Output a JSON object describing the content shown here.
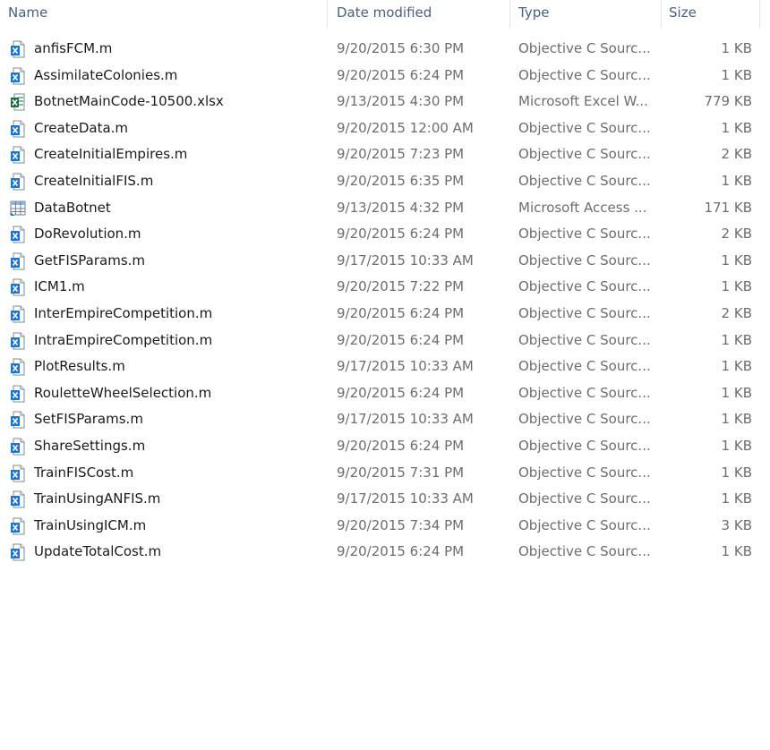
{
  "columns": {
    "name": "Name",
    "date": "Date modified",
    "type": "Type",
    "size": "Size"
  },
  "files": [
    {
      "name": "anfisFCM.m",
      "date": "9/20/2015 6:30 PM",
      "type": "Objective C Sourc...",
      "size": "1 KB",
      "icon": "objective-c-file-icon"
    },
    {
      "name": "AssimilateColonies.m",
      "date": "9/20/2015 6:24 PM",
      "type": "Objective C Sourc...",
      "size": "1 KB",
      "icon": "objective-c-file-icon"
    },
    {
      "name": "BotnetMainCode-10500.xlsx",
      "date": "9/13/2015 4:30 PM",
      "type": "Microsoft Excel W...",
      "size": "779 KB",
      "icon": "excel-file-icon"
    },
    {
      "name": "CreateData.m",
      "date": "9/20/2015 12:00 AM",
      "type": "Objective C Sourc...",
      "size": "1 KB",
      "icon": "objective-c-file-icon"
    },
    {
      "name": "CreateInitialEmpires.m",
      "date": "9/20/2015 7:23 PM",
      "type": "Objective C Sourc...",
      "size": "2 KB",
      "icon": "objective-c-file-icon"
    },
    {
      "name": "CreateInitialFIS.m",
      "date": "9/20/2015 6:35 PM",
      "type": "Objective C Sourc...",
      "size": "1 KB",
      "icon": "objective-c-file-icon"
    },
    {
      "name": "DataBotnet",
      "date": "9/13/2015 4:32 PM",
      "type": "Microsoft Access ...",
      "size": "171 KB",
      "icon": "access-table-icon"
    },
    {
      "name": "DoRevolution.m",
      "date": "9/20/2015 6:24 PM",
      "type": "Objective C Sourc...",
      "size": "2 KB",
      "icon": "objective-c-file-icon"
    },
    {
      "name": "GetFISParams.m",
      "date": "9/17/2015 10:33 AM",
      "type": "Objective C Sourc...",
      "size": "1 KB",
      "icon": "objective-c-file-icon"
    },
    {
      "name": "ICM1.m",
      "date": "9/20/2015 7:22 PM",
      "type": "Objective C Sourc...",
      "size": "1 KB",
      "icon": "objective-c-file-icon"
    },
    {
      "name": "InterEmpireCompetition.m",
      "date": "9/20/2015 6:24 PM",
      "type": "Objective C Sourc...",
      "size": "2 KB",
      "icon": "objective-c-file-icon"
    },
    {
      "name": "IntraEmpireCompetition.m",
      "date": "9/20/2015 6:24 PM",
      "type": "Objective C Sourc...",
      "size": "1 KB",
      "icon": "objective-c-file-icon"
    },
    {
      "name": "PlotResults.m",
      "date": "9/17/2015 10:33 AM",
      "type": "Objective C Sourc...",
      "size": "1 KB",
      "icon": "objective-c-file-icon"
    },
    {
      "name": "RouletteWheelSelection.m",
      "date": "9/20/2015 6:24 PM",
      "type": "Objective C Sourc...",
      "size": "1 KB",
      "icon": "objective-c-file-icon"
    },
    {
      "name": "SetFISParams.m",
      "date": "9/17/2015 10:33 AM",
      "type": "Objective C Sourc...",
      "size": "1 KB",
      "icon": "objective-c-file-icon"
    },
    {
      "name": "ShareSettings.m",
      "date": "9/20/2015 6:24 PM",
      "type": "Objective C Sourc...",
      "size": "1 KB",
      "icon": "objective-c-file-icon"
    },
    {
      "name": "TrainFISCost.m",
      "date": "9/20/2015 7:31 PM",
      "type": "Objective C Sourc...",
      "size": "1 KB",
      "icon": "objective-c-file-icon"
    },
    {
      "name": "TrainUsingANFIS.m",
      "date": "9/17/2015 10:33 AM",
      "type": "Objective C Sourc...",
      "size": "1 KB",
      "icon": "objective-c-file-icon"
    },
    {
      "name": "TrainUsingICM.m",
      "date": "9/20/2015 7:34 PM",
      "type": "Objective C Sourc...",
      "size": "3 KB",
      "icon": "objective-c-file-icon"
    },
    {
      "name": "UpdateTotalCost.m",
      "date": "9/20/2015 6:24 PM",
      "type": "Objective C Sourc...",
      "size": "1 KB",
      "icon": "objective-c-file-icon"
    }
  ],
  "colors": {
    "header_text": "#4c607a",
    "name_text": "#1a1a1a",
    "detail_text": "#6d6d6d",
    "objc_icon_blue": "#1e74c8",
    "excel_icon_green": "#1d7044"
  }
}
